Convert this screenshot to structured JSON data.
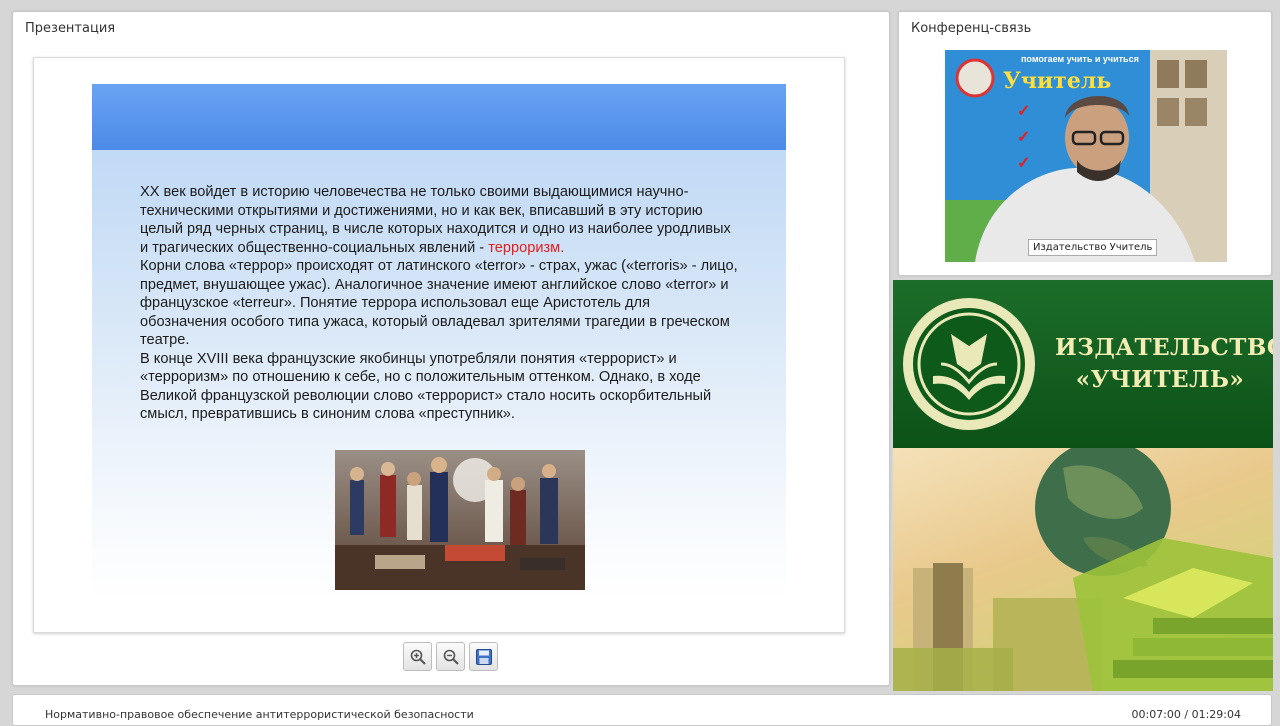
{
  "presentation": {
    "title": "Презентация",
    "slide": {
      "paragraphs": [
        "XX век войдет в историю человечества не только своими выдающимися научно-техническими открытиями и достижениями, но и как век, вписавший в эту историю целый ряд черных страниц, в числе которых находится и одно из наиболее уродливых и трагических общественно-социальных явлений -",
        "Корни слова «террор» происходят от латинского «terror» - страх, ужас («terroris» - лицо, предмет, внушающее ужас). Аналогичное значение имеют английское слово «terror» и французское «terreur». Понятие террора использовал еще Аристотель для обозначения особого типа ужаса, который овладевал зрителями трагедии в греческом театре.",
        "В конце XVIII века французские якобинцы употребляли понятия «террорист» и «терроризм» по отношению к себе, но с положительным оттенком. Однако, в ходе Великой французской революции слово «террорист» стало носить оскорбительный смысл, превратившись в синоним слова «преступник»."
      ],
      "highlight": "терроризм.",
      "highlight_color": "#e02020",
      "band_color": "#4b8ae8"
    },
    "toolbar": {
      "zoom_in_icon": "zoom-in-icon",
      "zoom_out_icon": "zoom-out-icon",
      "save_icon": "save-icon"
    }
  },
  "conference": {
    "title": "Конференц-связь",
    "video": {
      "caption": "Издательство Учитель",
      "poster_brand": "Учитель",
      "poster_tagline": "помогаем учить и учиться"
    }
  },
  "publisher": {
    "name_line1": "ИЗДАТЕЛЬСТВО",
    "name_line2": "«УЧИТЕЛЬ»",
    "brand_color": "#0c5218"
  },
  "footer": {
    "course_title": "Нормативно-правовое обеспечение антитеррористической безопасности",
    "time": "00:07:00 / 01:29:04"
  }
}
